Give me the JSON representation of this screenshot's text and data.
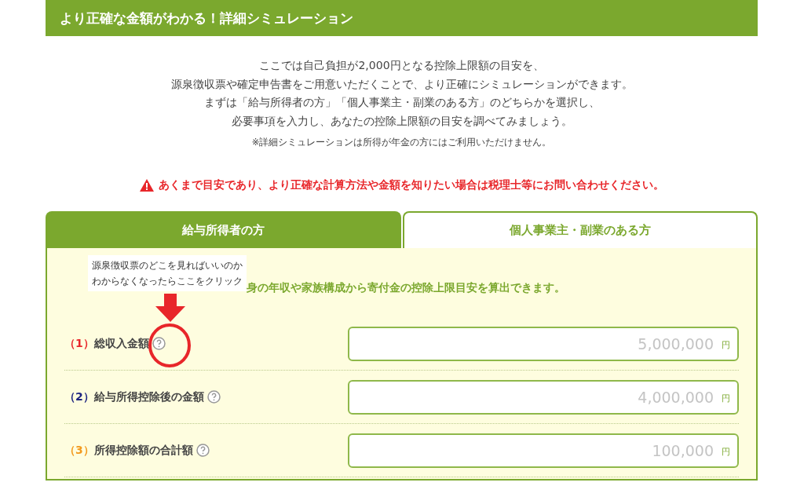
{
  "header": {
    "title": "より正確な金額がわかる！詳細シミュレーション"
  },
  "intro": {
    "lines": [
      "ここでは自己負担が2,000円となる控除上限額の目安を、",
      "源泉徴収票や確定申告書をご用意いただくことで、より正確にシミュレーションができます。",
      "まずは「給与所得者の方」「個人事業主・副業のある方」のどちらかを選択し、",
      "必要事項を入力し、あなたの控除上限額の目安を調べてみましょう。"
    ],
    "note": "※詳細シミュレーションは所得が年金の方にはご利用いただけません。"
  },
  "warning": "あくまで目安であり、より正確な計算方法や金額を知りたい場合は税理士等にお問い合わせください。",
  "tabs": [
    {
      "label": "給与所得者の方",
      "selected": true
    },
    {
      "label": "個人事業主・副業のある方",
      "selected": false
    }
  ],
  "panel": {
    "lead": "身の年収や家族構成から寄付金の控除上限目安を算出できます。",
    "rows": [
      {
        "number": "（1）",
        "color": "#e8262a",
        "label": "総収入金額",
        "placeholder": "5,000,000",
        "unit": "円"
      },
      {
        "number": "（2）",
        "color": "#1d2480",
        "label": "給与所得控除後の金額",
        "placeholder": "4,000,000",
        "unit": "円"
      },
      {
        "number": "（3）",
        "color": "#f39a1e",
        "label": "所得控除額の合計額",
        "placeholder": "100,000",
        "unit": "円"
      }
    ]
  },
  "annotation": {
    "callout": [
      "源泉徴収票のどこを見ればいいのか",
      "わからなくなったらここをクリック"
    ]
  }
}
